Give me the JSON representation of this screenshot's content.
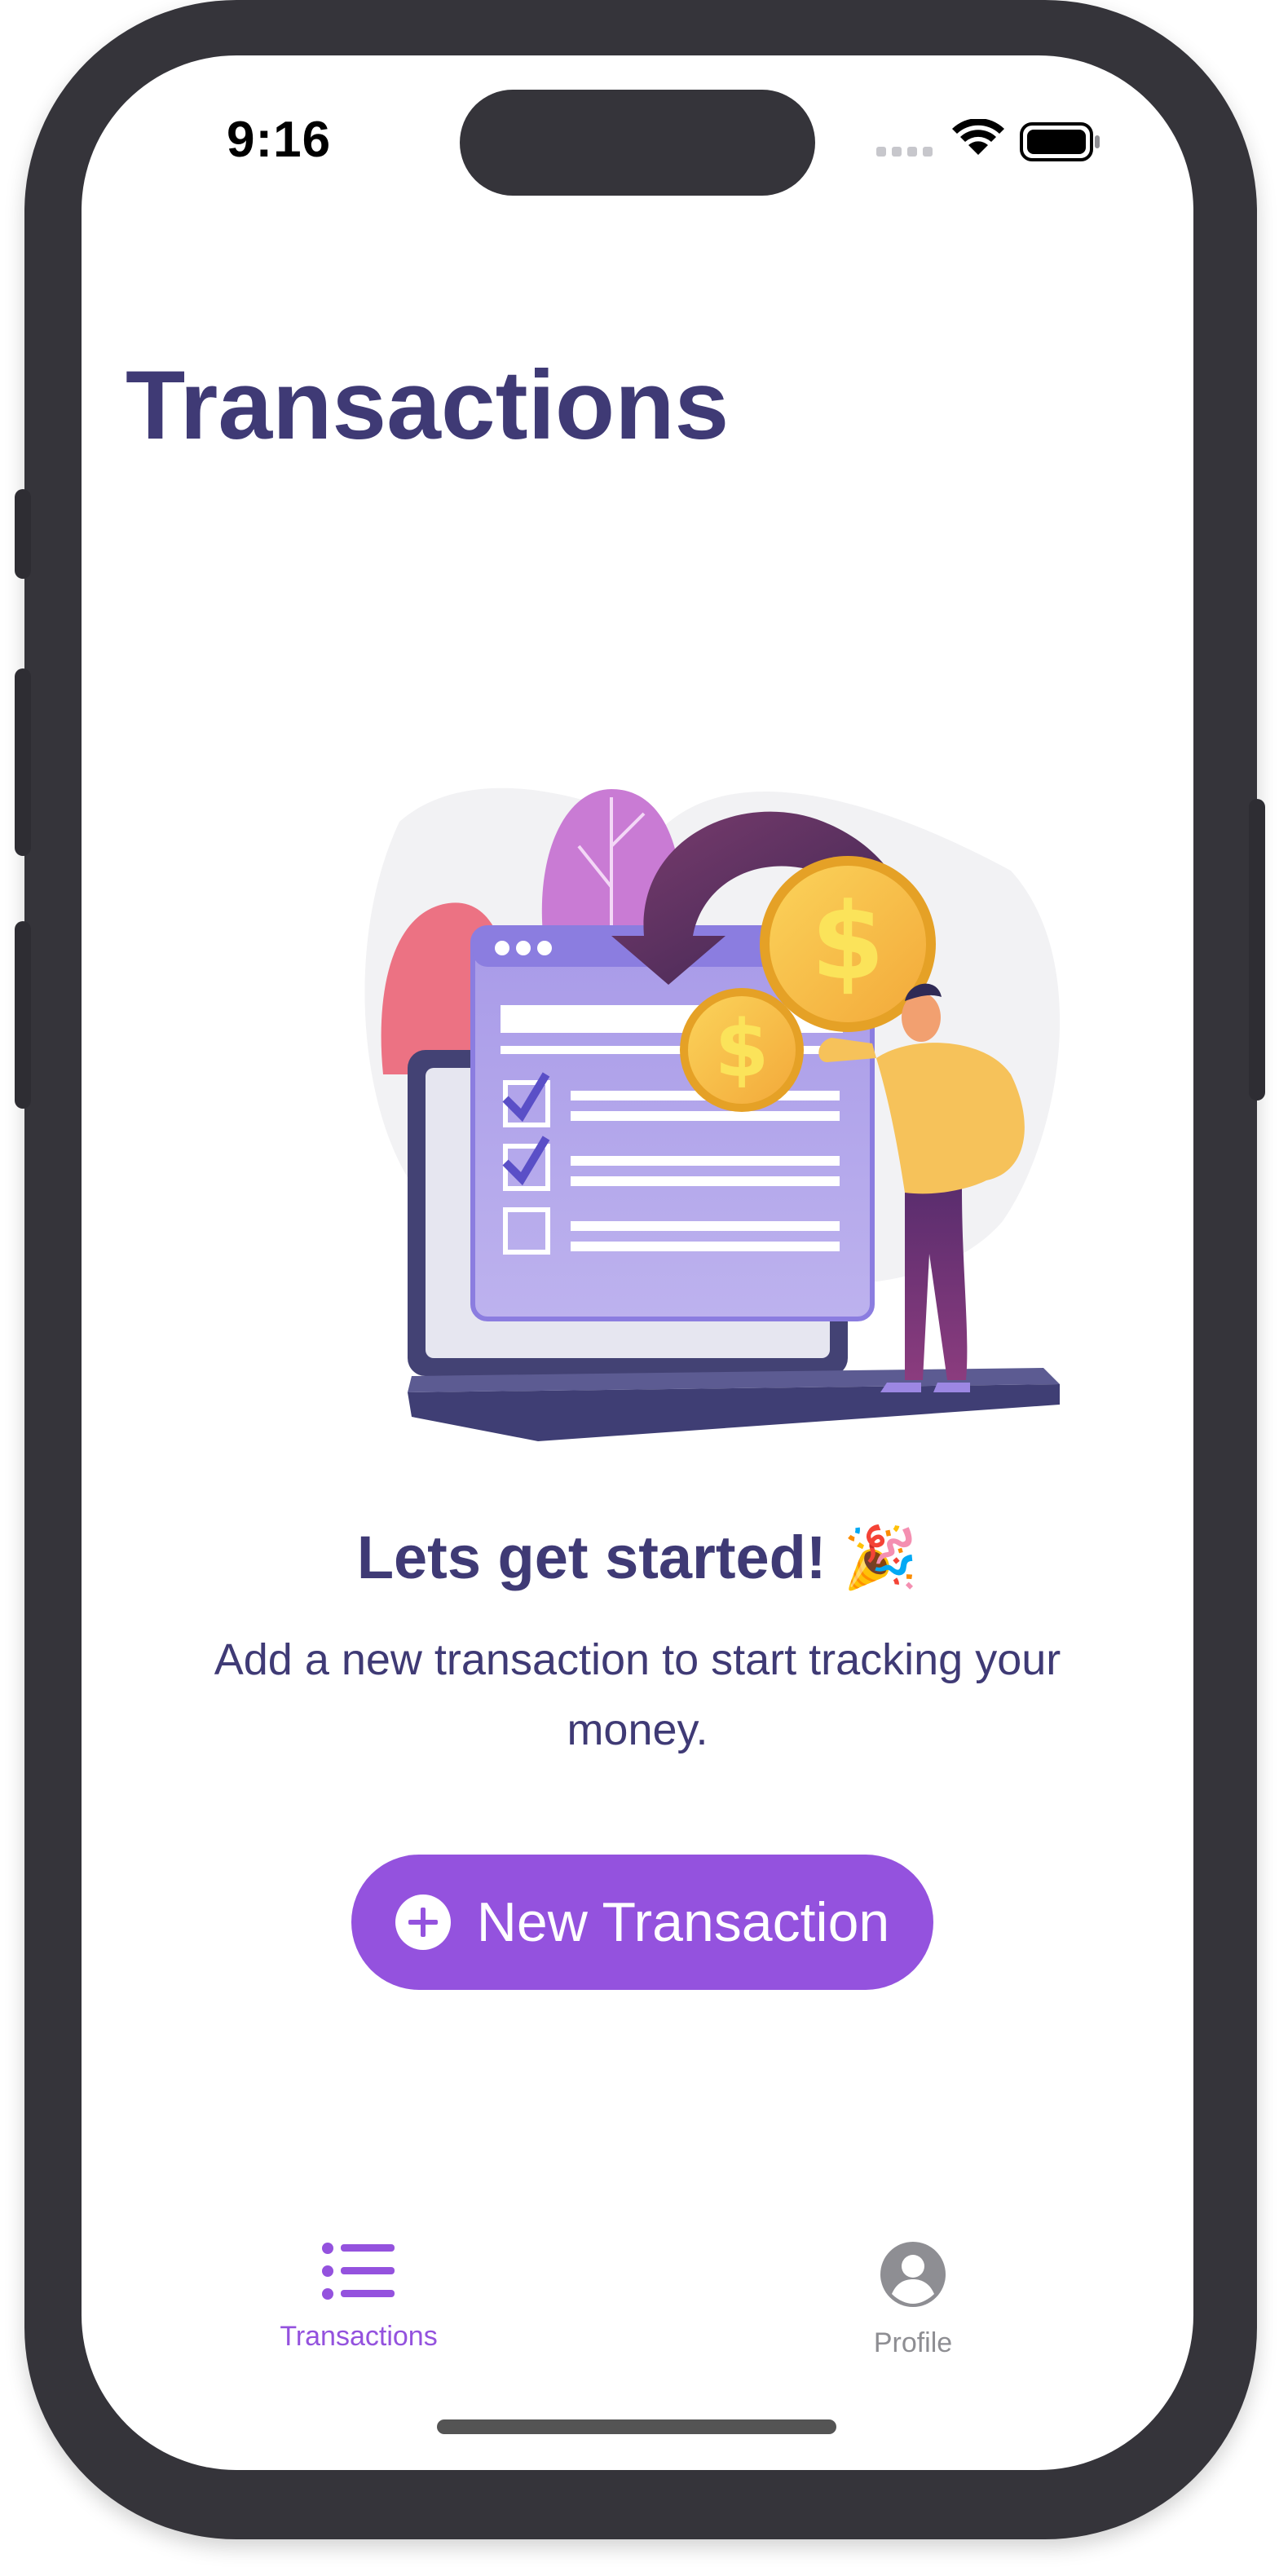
{
  "status_bar": {
    "time": "9:16"
  },
  "header": {
    "title": "Transactions"
  },
  "empty_state": {
    "headline": "Lets get started! 🎉",
    "message": "Add a new transaction to start tracking your money."
  },
  "actions": {
    "new_transaction_label": "New Transaction"
  },
  "tab_bar": {
    "items": [
      {
        "label": "Transactions",
        "icon": "list-icon",
        "active": true
      },
      {
        "label": "Profile",
        "icon": "person-circle-icon",
        "active": false
      }
    ]
  },
  "colors": {
    "accent": "#9452de",
    "title": "#3f3a75",
    "inactive": "#8e8e93",
    "frame": "#35343a"
  }
}
